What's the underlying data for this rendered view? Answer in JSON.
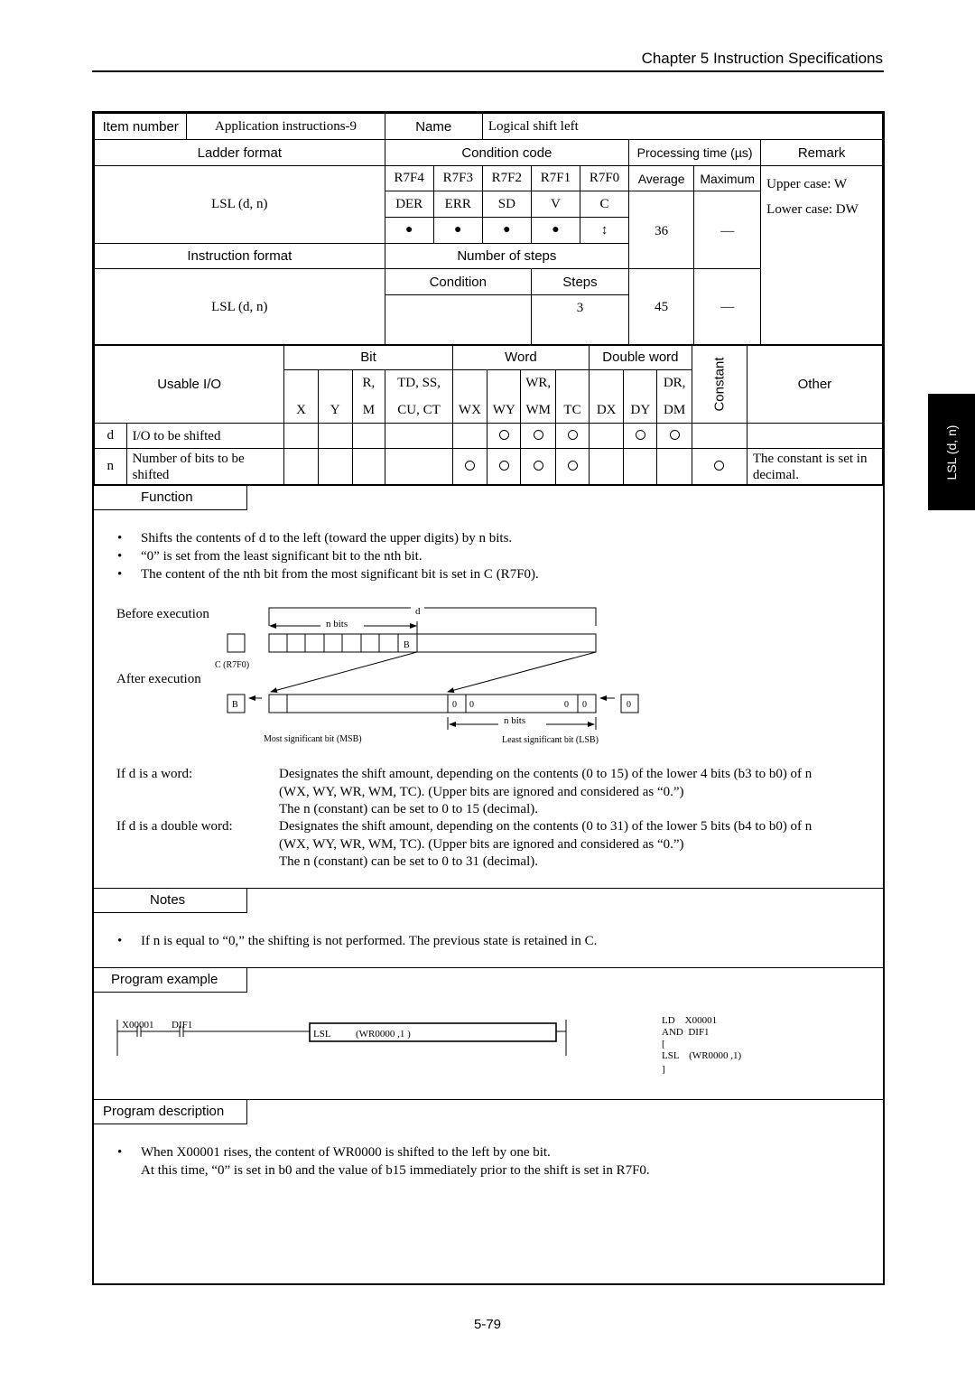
{
  "header": {
    "chapter_title": "Chapter 5  Instruction Specifications"
  },
  "side_tab": {
    "label": "LSL (d, n)"
  },
  "spec": {
    "item_number_label": "Item number",
    "item_number_value": "Application instructions-9",
    "name_label": "Name",
    "name_value": "Logical shift left",
    "ladder_format_label": "Ladder format",
    "ladder_format_value": "LSL (d, n)",
    "condition_code_label": "Condition code",
    "processing_time_label": "Processing time (µs)",
    "remark_label": "Remark",
    "registers": [
      "R7F4",
      "R7F3",
      "R7F2",
      "R7F1",
      "R7F0"
    ],
    "flags": [
      "DER",
      "ERR",
      "SD",
      "V",
      "C"
    ],
    "flag_states": [
      "●",
      "●",
      "●",
      "●",
      "↕"
    ],
    "average_label": "Average",
    "maximum_label": "Maximum",
    "average_value_1": "36",
    "maximum_value_1": "—",
    "remark_upper": "Upper case: W",
    "remark_lower": "Lower case: DW",
    "instruction_format_label": "Instruction format",
    "instruction_format_value": "LSL (d, n)",
    "number_of_steps_label": "Number of steps",
    "condition_label": "Condition",
    "steps_label": "Steps",
    "condition_value": "",
    "steps_value": "3",
    "average_value_2": "45",
    "maximum_value_2": "—"
  },
  "usable_io": {
    "label": "Usable I/O",
    "groups": {
      "bit": "Bit",
      "word": "Word",
      "double_word": "Double word",
      "constant": "Constant",
      "other": "Other"
    },
    "columns": [
      "X",
      "Y",
      "R, M",
      "TD, SS, CU, CT",
      "WX",
      "WY",
      "WR, WM",
      "TC",
      "DX",
      "DY",
      "DR, DM",
      "Constant"
    ],
    "col_top": [
      "",
      "",
      "R,",
      "TD, SS,",
      "",
      "",
      "WR,",
      "",
      "",
      "",
      "DR,"
    ],
    "col_bottom": [
      "X",
      "Y",
      "M",
      "CU, CT",
      "WX",
      "WY",
      "WM",
      "TC",
      "DX",
      "DY",
      "DM"
    ],
    "rows": [
      {
        "param": "d",
        "desc": "I/O to be shifted",
        "marks": [
          false,
          false,
          false,
          false,
          false,
          true,
          true,
          true,
          false,
          true,
          true,
          false
        ],
        "other": ""
      },
      {
        "param": "n",
        "desc": "Number of bits to be shifted",
        "marks": [
          false,
          false,
          false,
          false,
          true,
          true,
          true,
          true,
          false,
          false,
          false,
          true
        ],
        "other": "The constant is set in decimal."
      }
    ]
  },
  "function": {
    "label": "Function",
    "bullets": [
      "Shifts the contents of d to the left (toward the upper digits) by n bits.",
      "“0” is set from the least significant bit to the nth bit.",
      "The content of the nth bit from the most significant bit is set in C (R7F0)."
    ],
    "diagram": {
      "before_label": "Before execution",
      "after_label": "After execution",
      "d_label": "d",
      "n_bits_label": "n bits",
      "carry_label": "C (R7F0)",
      "b_label": "B",
      "zero": "0",
      "msb_label": "Most significant bit (MSB)",
      "lsb_label": "Least significant bit (LSB)"
    },
    "word_case_label": "If d is a word:",
    "word_case_lines": [
      "Designates the shift amount, depending on the contents (0 to 15) of the lower 4 bits (b3 to b0) of n",
      "(WX, WY, WR, WM, TC).  (Upper bits are ignored and considered as “0.”)",
      "The n (constant) can be set to 0 to 15 (decimal)."
    ],
    "dword_case_label": "If d is a double word:",
    "dword_case_lines": [
      "Designates the shift amount, depending on the contents (0 to 31) of the lower 5 bits (b4 to b0) of n",
      "(WX, WY, WR, WM, TC). (Upper bits are ignored and considered as “0.”)",
      "The n (constant) can be set to 0 to 31 (decimal)."
    ]
  },
  "notes": {
    "label": "Notes",
    "bullets": [
      "If n is equal to “0,” the shifting is not performed.  The previous state is retained in C."
    ]
  },
  "program_example": {
    "label": "Program example",
    "contact1": "X00001",
    "contact2": "DIF1",
    "box_op": "LSL",
    "box_args": "(WR0000 ,1 )",
    "mnemonic": [
      "LD    X00001",
      "AND  DIF1",
      "[",
      "LSL    (WR0000 ,1)",
      "]"
    ]
  },
  "program_description": {
    "label": "Program description",
    "bullet": "When X00001 rises, the content of WR0000 is shifted to the left by one bit.",
    "continuation": "At this time, “0” is set in b0 and the value of b15 immediately prior to the shift is set in R7F0."
  },
  "footer": {
    "page_number": "5-79"
  }
}
